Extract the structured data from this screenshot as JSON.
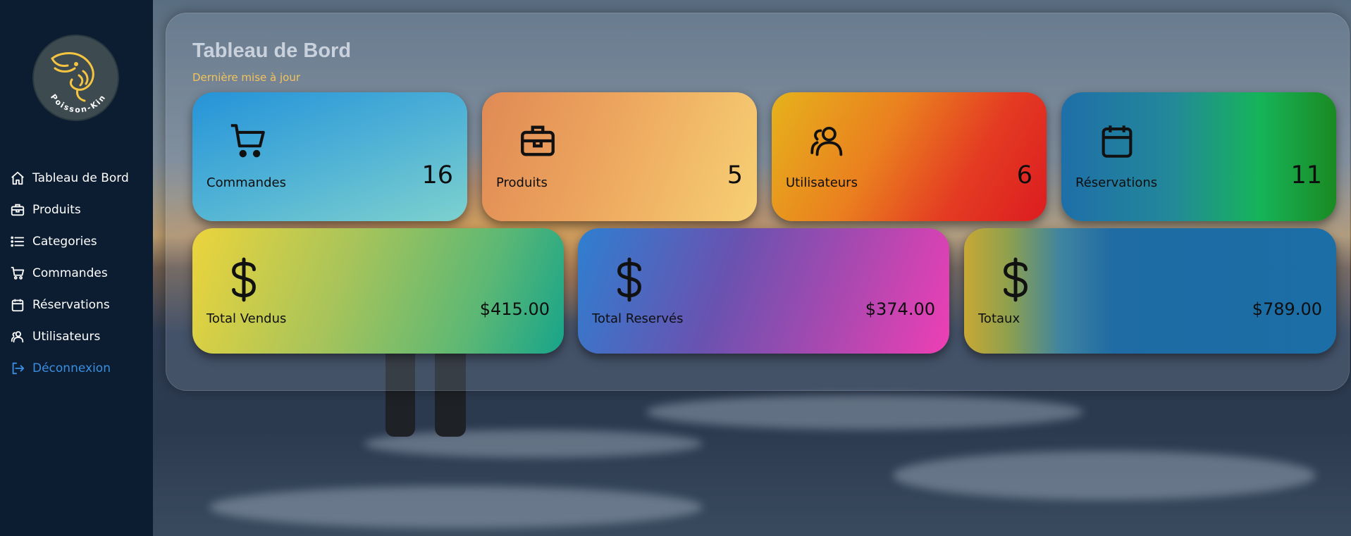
{
  "brand": {
    "logo_text": "Poisson-Kin"
  },
  "sidebar": {
    "items": [
      {
        "label": "Tableau de Bord",
        "icon": "home-icon"
      },
      {
        "label": "Produits",
        "icon": "briefcase-icon"
      },
      {
        "label": "Categories",
        "icon": "list-icon"
      },
      {
        "label": "Commandes",
        "icon": "cart-icon"
      },
      {
        "label": "Réservations",
        "icon": "calendar-icon"
      },
      {
        "label": "Utilisateurs",
        "icon": "users-icon"
      },
      {
        "label": "Déconnexion",
        "icon": "logout-icon"
      }
    ]
  },
  "dashboard": {
    "title": "Tableau de Bord",
    "subtitle": "Dernière mise à jour",
    "stats": [
      {
        "label": "Commandes",
        "value": "16",
        "icon": "cart-icon"
      },
      {
        "label": "Produits",
        "value": "5",
        "icon": "briefcase-icon"
      },
      {
        "label": "Utilisateurs",
        "value": "6",
        "icon": "users-icon"
      },
      {
        "label": "Réservations",
        "value": "11",
        "icon": "calendar-icon"
      }
    ],
    "totals": [
      {
        "label": "Total Vendus",
        "value": "$415.00",
        "icon": "dollar-icon"
      },
      {
        "label": "Total Reservés",
        "value": "$374.00",
        "icon": "dollar-icon"
      },
      {
        "label": "Totaux",
        "value": "$789.00",
        "icon": "dollar-icon"
      }
    ]
  },
  "colors": {
    "sidebar_bg": "#0c1c31",
    "logout": "#3b8fe0",
    "subtitle": "#f3c45a",
    "logo_gold": "#f5c542"
  }
}
